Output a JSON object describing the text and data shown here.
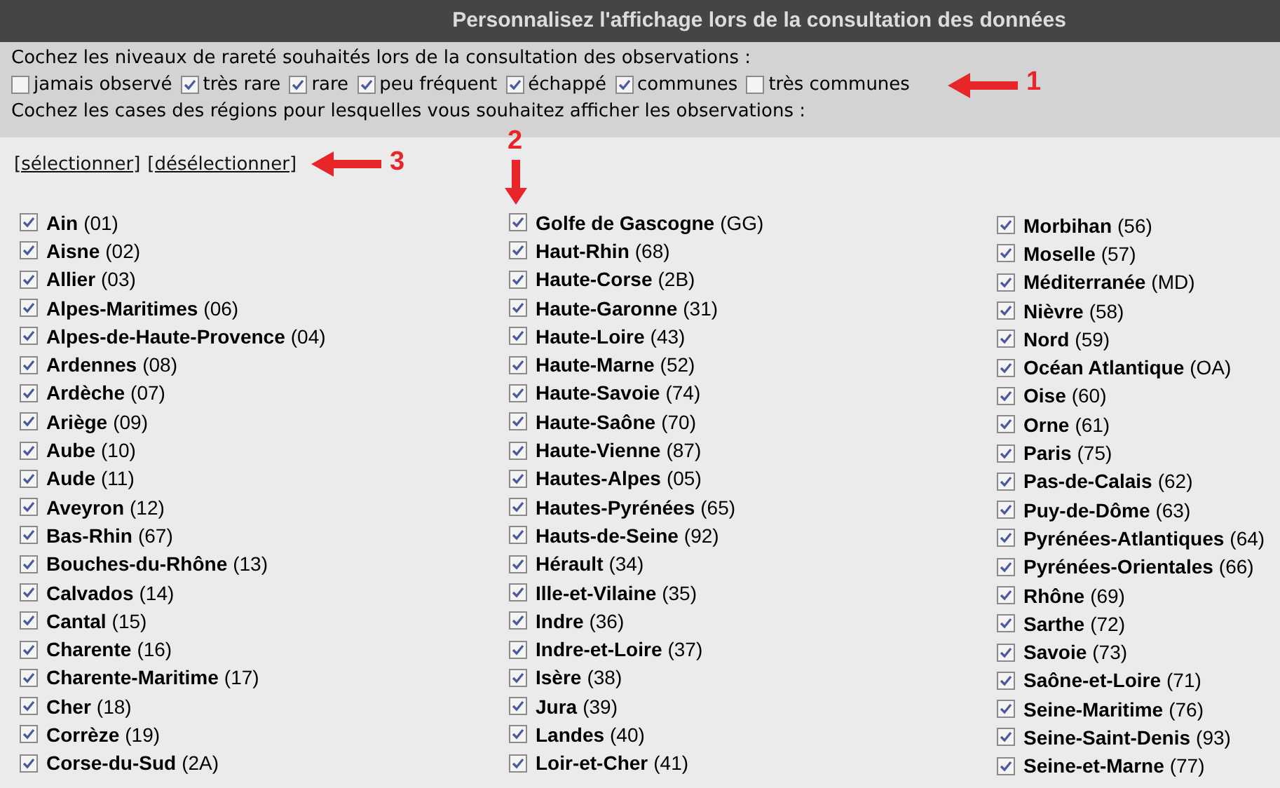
{
  "header": {
    "title": "Personnalisez l'affichage lors de la consultation des données"
  },
  "rarity": {
    "prompt": "Cochez les niveaux de rareté souhaités lors de la consultation des observations :",
    "options": [
      {
        "label": "jamais observé",
        "checked": false
      },
      {
        "label": "très rare",
        "checked": true
      },
      {
        "label": "rare",
        "checked": true
      },
      {
        "label": "peu fréquent",
        "checked": true
      },
      {
        "label": "échappé",
        "checked": true
      },
      {
        "label": "communes",
        "checked": true
      },
      {
        "label": "très communes",
        "checked": false
      }
    ]
  },
  "regions_prompt": "Cochez les cases des régions pour lesquelles vous souhaitez afficher les observations :",
  "links": [
    "[sélectionner]",
    "[désélectionner]"
  ],
  "columns": [
    [
      {
        "name": "Ain",
        "code": "(01)",
        "checked": true
      },
      {
        "name": "Aisne",
        "code": "(02)",
        "checked": true
      },
      {
        "name": "Allier",
        "code": "(03)",
        "checked": true
      },
      {
        "name": "Alpes-Maritimes",
        "code": "(06)",
        "checked": true
      },
      {
        "name": "Alpes-de-Haute-Provence",
        "code": "(04)",
        "checked": true
      },
      {
        "name": "Ardennes",
        "code": "(08)",
        "checked": true
      },
      {
        "name": "Ardèche",
        "code": "(07)",
        "checked": true
      },
      {
        "name": "Ariège",
        "code": "(09)",
        "checked": true
      },
      {
        "name": "Aube",
        "code": "(10)",
        "checked": true
      },
      {
        "name": "Aude",
        "code": "(11)",
        "checked": true
      },
      {
        "name": "Aveyron",
        "code": "(12)",
        "checked": true
      },
      {
        "name": "Bas-Rhin",
        "code": "(67)",
        "checked": true
      },
      {
        "name": "Bouches-du-Rhône",
        "code": "(13)",
        "checked": true
      },
      {
        "name": "Calvados",
        "code": "(14)",
        "checked": true
      },
      {
        "name": "Cantal",
        "code": "(15)",
        "checked": true
      },
      {
        "name": "Charente",
        "code": "(16)",
        "checked": true
      },
      {
        "name": "Charente-Maritime",
        "code": "(17)",
        "checked": true
      },
      {
        "name": "Cher",
        "code": "(18)",
        "checked": true
      },
      {
        "name": "Corrèze",
        "code": "(19)",
        "checked": true
      },
      {
        "name": "Corse-du-Sud",
        "code": "(2A)",
        "checked": true
      }
    ],
    [
      {
        "name": "Golfe de Gascogne",
        "code": "(GG)",
        "checked": true
      },
      {
        "name": "Haut-Rhin",
        "code": "(68)",
        "checked": true
      },
      {
        "name": "Haute-Corse",
        "code": "(2B)",
        "checked": true
      },
      {
        "name": "Haute-Garonne",
        "code": "(31)",
        "checked": true
      },
      {
        "name": "Haute-Loire",
        "code": "(43)",
        "checked": true
      },
      {
        "name": "Haute-Marne",
        "code": "(52)",
        "checked": true
      },
      {
        "name": "Haute-Savoie",
        "code": "(74)",
        "checked": true
      },
      {
        "name": "Haute-Saône",
        "code": "(70)",
        "checked": true
      },
      {
        "name": "Haute-Vienne",
        "code": "(87)",
        "checked": true
      },
      {
        "name": "Hautes-Alpes",
        "code": "(05)",
        "checked": true
      },
      {
        "name": "Hautes-Pyrénées",
        "code": "(65)",
        "checked": true
      },
      {
        "name": "Hauts-de-Seine",
        "code": "(92)",
        "checked": true
      },
      {
        "name": "Hérault",
        "code": "(34)",
        "checked": true
      },
      {
        "name": "Ille-et-Vilaine",
        "code": "(35)",
        "checked": true
      },
      {
        "name": "Indre",
        "code": "(36)",
        "checked": true
      },
      {
        "name": "Indre-et-Loire",
        "code": "(37)",
        "checked": true
      },
      {
        "name": "Isère",
        "code": "(38)",
        "checked": true
      },
      {
        "name": "Jura",
        "code": "(39)",
        "checked": true
      },
      {
        "name": "Landes",
        "code": "(40)",
        "checked": true
      },
      {
        "name": "Loir-et-Cher",
        "code": "(41)",
        "checked": true
      }
    ],
    [
      {
        "name": "Morbihan",
        "code": "(56)",
        "checked": true
      },
      {
        "name": "Moselle",
        "code": "(57)",
        "checked": true
      },
      {
        "name": "Méditerranée",
        "code": "(MD)",
        "checked": true
      },
      {
        "name": "Nièvre",
        "code": "(58)",
        "checked": true
      },
      {
        "name": "Nord",
        "code": "(59)",
        "checked": true
      },
      {
        "name": "Océan Atlantique",
        "code": "(OA)",
        "checked": true
      },
      {
        "name": "Oise",
        "code": "(60)",
        "checked": true
      },
      {
        "name": "Orne",
        "code": "(61)",
        "checked": true
      },
      {
        "name": "Paris",
        "code": "(75)",
        "checked": true
      },
      {
        "name": "Pas-de-Calais",
        "code": "(62)",
        "checked": true
      },
      {
        "name": "Puy-de-Dôme",
        "code": "(63)",
        "checked": true
      },
      {
        "name": "Pyrénées-Atlantiques",
        "code": "(64)",
        "checked": true
      },
      {
        "name": "Pyrénées-Orientales",
        "code": "(66)",
        "checked": true
      },
      {
        "name": "Rhône",
        "code": "(69)",
        "checked": true
      },
      {
        "name": "Sarthe",
        "code": "(72)",
        "checked": true
      },
      {
        "name": "Savoie",
        "code": "(73)",
        "checked": true
      },
      {
        "name": "Saône-et-Loire",
        "code": "(71)",
        "checked": true
      },
      {
        "name": "Seine-Maritime",
        "code": "(76)",
        "checked": true
      },
      {
        "name": "Seine-Saint-Denis",
        "code": "(93)",
        "checked": true
      },
      {
        "name": "Seine-et-Marne",
        "code": "(77)",
        "checked": true
      }
    ]
  ],
  "annotations": [
    {
      "label": "1",
      "kind": "left-arrow"
    },
    {
      "label": "2",
      "kind": "down-arrow"
    },
    {
      "label": "3",
      "kind": "left-arrow"
    }
  ]
}
